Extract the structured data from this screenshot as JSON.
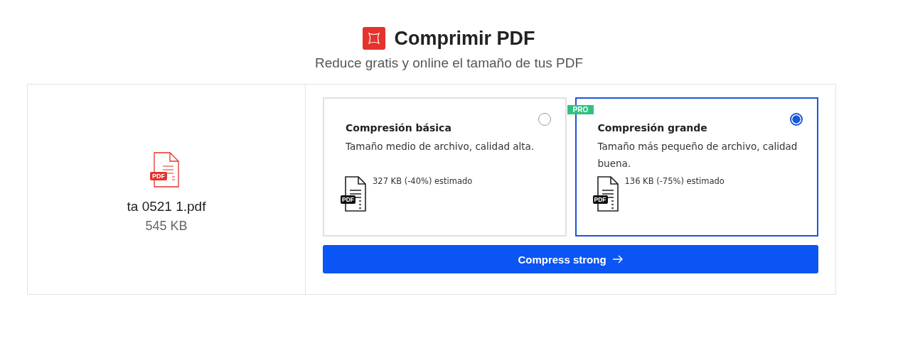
{
  "header": {
    "title": "Comprimir PDF",
    "subtitle": "Reduce gratis y online el tamaño de tus PDF"
  },
  "file": {
    "icon_label": "PDF",
    "name": "ta 0521 1.pdf",
    "size": "545 KB"
  },
  "options": [
    {
      "title": "Compresión básica",
      "description": "Tamaño medio de archivo, calidad alta.",
      "icon_label": "PDF",
      "estimate": "327 KB (-40%) estimado",
      "selected": false
    },
    {
      "badge": "PRO",
      "title": "Compresión grande",
      "description": "Tamaño más pequeño de archivo, calidad buena.",
      "icon_label": "PDF",
      "estimate": "136 KB (-75%) estimado",
      "selected": true
    }
  ],
  "action_button": {
    "label": "Compress strong"
  }
}
